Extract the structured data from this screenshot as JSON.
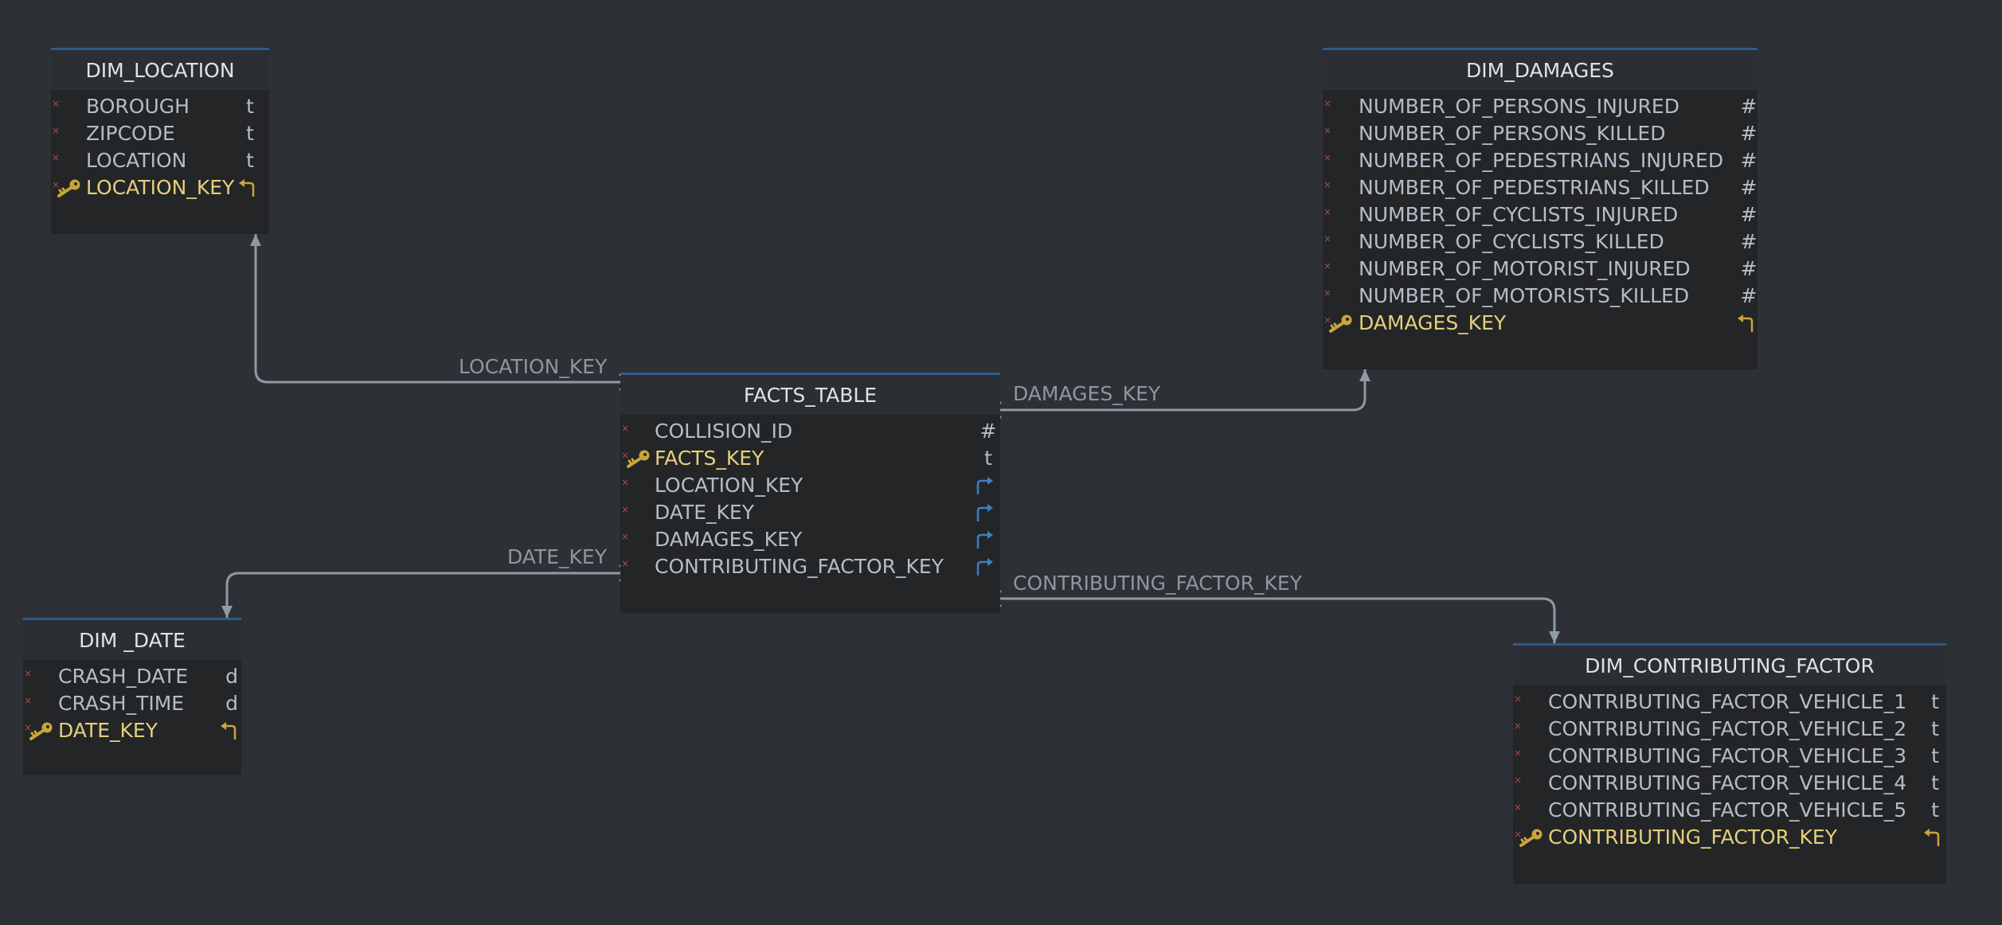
{
  "colors": {
    "background": "#2d3035",
    "table_body": "#232527",
    "table_header": "#2b2e32",
    "table_border": "#2f5b8c",
    "column_text": "#b4bdc8",
    "primary_key_text": "#e6cf7c",
    "key_icon": "#c9a53a",
    "fk_icon": "#3d7fc7",
    "not_null_mark": "#a84b43",
    "relationship_line": "#8e9aa4",
    "label_text": "#8e969f"
  },
  "tables": [
    {
      "id": "dim_location",
      "name": "DIM_LOCATION",
      "columns": [
        {
          "name": "BOROUGH",
          "type": "t",
          "key": false
        },
        {
          "name": "ZIPCODE",
          "type": "t",
          "key": false
        },
        {
          "name": "LOCATION",
          "type": "t",
          "key": false
        },
        {
          "name": "LOCATION_KEY",
          "type": "pk-return-icon",
          "key": true
        }
      ]
    },
    {
      "id": "dim_damages",
      "name": "DIM_DAMAGES",
      "columns": [
        {
          "name": "NUMBER_OF_PERSONS_INJURED",
          "type": "#",
          "key": false
        },
        {
          "name": "NUMBER_OF_PERSONS_KILLED",
          "type": "#",
          "key": false
        },
        {
          "name": "NUMBER_OF_PEDESTRIANS_INJURED",
          "type": "#",
          "key": false
        },
        {
          "name": "NUMBER_OF_PEDESTRIANS_KILLED",
          "type": "#",
          "key": false
        },
        {
          "name": "NUMBER_OF_CYCLISTS_INJURED",
          "type": "#",
          "key": false
        },
        {
          "name": "NUMBER_OF_CYCLISTS_KILLED",
          "type": "#",
          "key": false
        },
        {
          "name": "NUMBER_OF_MOTORIST_INJURED",
          "type": "#",
          "key": false
        },
        {
          "name": "NUMBER_OF_MOTORISTS_KILLED",
          "type": "#",
          "key": false
        },
        {
          "name": "DAMAGES_KEY",
          "type": "pk-return-icon",
          "key": true
        }
      ]
    },
    {
      "id": "facts_table",
      "name": "FACTS_TABLE",
      "columns": [
        {
          "name": "COLLISION_ID",
          "type": "#",
          "key": false
        },
        {
          "name": "FACTS_KEY",
          "type": "t",
          "key": true
        },
        {
          "name": "LOCATION_KEY",
          "type": "fk-icon",
          "key": false
        },
        {
          "name": "DATE_KEY",
          "type": "fk-icon",
          "key": false
        },
        {
          "name": "DAMAGES_KEY",
          "type": "fk-icon",
          "key": false
        },
        {
          "name": "CONTRIBUTING_FACTOR_KEY",
          "type": "fk-icon",
          "key": false
        }
      ]
    },
    {
      "id": "dim_date",
      "name": "DIM _DATE",
      "columns": [
        {
          "name": "CRASH_DATE",
          "type": "d",
          "key": false
        },
        {
          "name": "CRASH_TIME",
          "type": "d",
          "key": false
        },
        {
          "name": "DATE_KEY",
          "type": "pk-return-icon",
          "key": true
        }
      ]
    },
    {
      "id": "dim_contributing_factor",
      "name": "DIM_CONTRIBUTING_FACTOR",
      "columns": [
        {
          "name": "CONTRIBUTING_FACTOR_VEHICLE_1",
          "type": "t",
          "key": false
        },
        {
          "name": "CONTRIBUTING_FACTOR_VEHICLE_2",
          "type": "t",
          "key": false
        },
        {
          "name": "CONTRIBUTING_FACTOR_VEHICLE_3",
          "type": "t",
          "key": false
        },
        {
          "name": "CONTRIBUTING_FACTOR_VEHICLE_4",
          "type": "t",
          "key": false
        },
        {
          "name": "CONTRIBUTING_FACTOR_VEHICLE_5",
          "type": "t",
          "key": false
        },
        {
          "name": "CONTRIBUTING_FACTOR_KEY",
          "type": "pk-return-icon",
          "key": true
        }
      ]
    }
  ],
  "relationships": [
    {
      "label": "LOCATION_KEY",
      "from": "facts_table",
      "to": "dim_location"
    },
    {
      "label": "DAMAGES_KEY",
      "from": "facts_table",
      "to": "dim_damages"
    },
    {
      "label": "DATE_KEY",
      "from": "facts_table",
      "to": "dim_date"
    },
    {
      "label": "CONTRIBUTING_FACTOR_KEY",
      "from": "facts_table",
      "to": "dim_contributing_factor"
    }
  ]
}
